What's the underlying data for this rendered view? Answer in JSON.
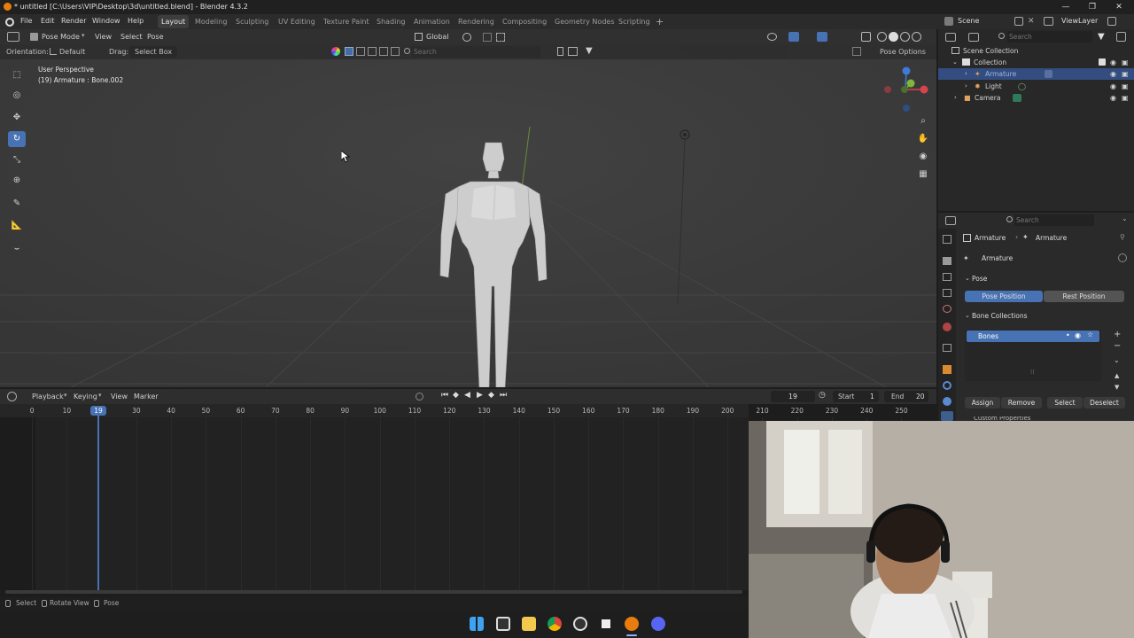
{
  "window": {
    "title": "* untitled [C:\\Users\\VIP\\Desktop\\3d\\untitled.blend] - Blender 4.3.2"
  },
  "menu": [
    "File",
    "Edit",
    "Render",
    "Window",
    "Help"
  ],
  "workspaces": [
    "Layout",
    "Modeling",
    "Sculpting",
    "UV Editing",
    "Texture Paint",
    "Shading",
    "Animation",
    "Rendering",
    "Compositing",
    "Geometry Nodes",
    "Scripting"
  ],
  "active_workspace": "Layout",
  "scene": {
    "name": "Scene",
    "view_layer": "ViewLayer"
  },
  "viewport": {
    "mode": "Pose Mode",
    "menus": [
      "View",
      "Select",
      "Pose"
    ],
    "transform_orientation": "Global",
    "orientation_label": "Orientation:",
    "orientation_value": "Default",
    "drag_label": "Drag:",
    "drag_value": "Select Box",
    "search_placeholder": "Search",
    "pose_options": "Pose Options",
    "overlay_line1": "User Perspective",
    "overlay_line2": "(19) Armature : Bone.002"
  },
  "outliner": {
    "search_placeholder": "Search",
    "items": {
      "root": "Scene Collection",
      "collection": "Collection",
      "armature": "Armature",
      "light": "Light",
      "camera": "Camera"
    }
  },
  "properties": {
    "search_placeholder": "Search",
    "breadcrumb_object": "Armature",
    "breadcrumb_data": "Armature",
    "datablock_name": "Armature",
    "pose_panel": "Pose",
    "pose_position": "Pose Position",
    "rest_position": "Rest Position",
    "bone_collections_panel": "Bone Collections",
    "bone_collection_item": "Bones",
    "assign": "Assign",
    "remove": "Remove",
    "select": "Select",
    "deselect": "Deselect",
    "custom_properties": "Custom Properties"
  },
  "timeline": {
    "menus": [
      "Playback",
      "Keying",
      "View",
      "Marker"
    ],
    "current_frame": "19",
    "start_label": "Start",
    "start": "1",
    "end_label": "End",
    "end": "20",
    "ruler_ticks": [
      "0",
      "10",
      "30",
      "40",
      "50",
      "60",
      "70",
      "80",
      "90",
      "100",
      "110",
      "120",
      "130",
      "140",
      "150",
      "160",
      "170",
      "180",
      "190",
      "200",
      "210",
      "220",
      "230",
      "240",
      "250"
    ],
    "playhead": "19"
  },
  "statusbar": {
    "select": "Select",
    "rotate_view": "Rotate View",
    "pose": "Pose"
  },
  "colors": {
    "accent": "#4772b3",
    "playhead": "#4772b3",
    "selected_row": "#334d80"
  }
}
